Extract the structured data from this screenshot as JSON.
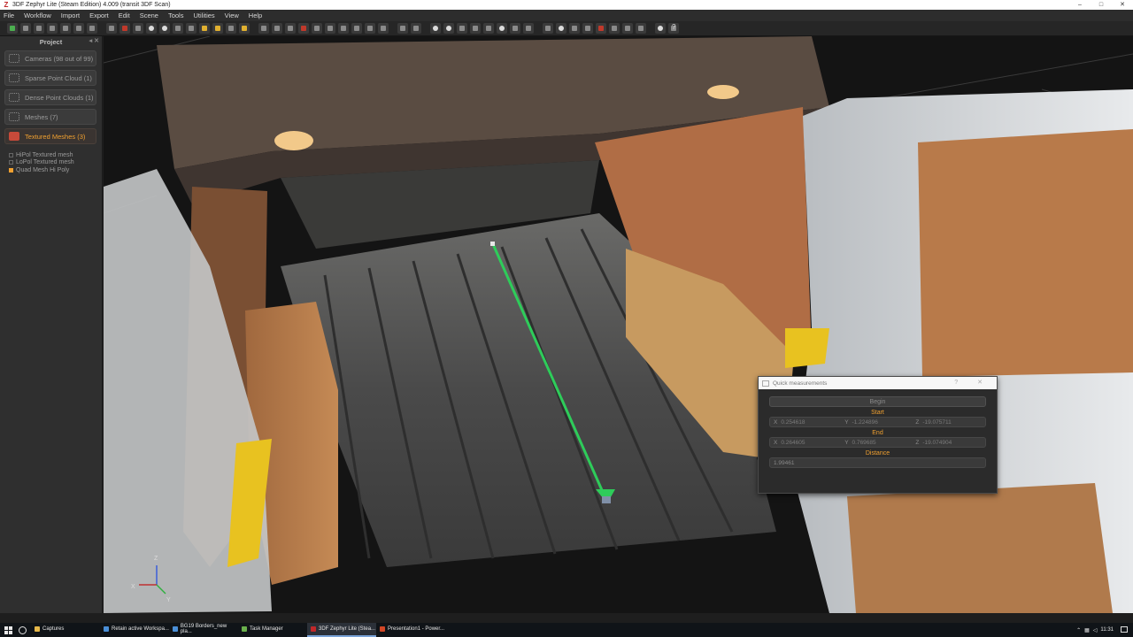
{
  "window": {
    "title": "3DF Zephyr Lite (Steam Edition) 4.009 (transit 3DF Scan)",
    "controls": [
      "–",
      "□",
      "✕"
    ]
  },
  "menu": [
    "File",
    "Workflow",
    "Import",
    "Export",
    "Edit",
    "Scene",
    "Tools",
    "Utilities",
    "View",
    "Help"
  ],
  "toolbar": {
    "help_label": "?"
  },
  "project": {
    "header": "Project",
    "items": [
      {
        "label": "Cameras (98 out of 99)",
        "active": false
      },
      {
        "label": "Sparse Point Cloud (1)",
        "active": false
      },
      {
        "label": "Dense Point Clouds (1)",
        "active": false
      },
      {
        "label": "Meshes (7)",
        "active": false
      },
      {
        "label": "Textured Meshes (3)",
        "active": true
      }
    ],
    "meshes": [
      {
        "label": "HiPol Textured mesh",
        "selected": false
      },
      {
        "label": "LoPol Textured mesh",
        "selected": false
      },
      {
        "label": "Quad Mesh Hi Poly",
        "selected": true
      }
    ]
  },
  "gizmo": {
    "z": "Z",
    "x": "X",
    "y": "Y"
  },
  "quick_measurements": {
    "title": "Quick measurements",
    "begin": "Begin",
    "start_label": "Start",
    "start": {
      "x": "0.254618",
      "y": "-1.224896",
      "z": "-19.075711"
    },
    "end_label": "End",
    "end": {
      "x": "0.264605",
      "y": "0.769685",
      "z": "-19.074904"
    },
    "distance_label": "Distance",
    "distance": "1.99461",
    "axis_x": "X",
    "axis_y": "Y",
    "axis_z": "Z"
  },
  "taskbar": {
    "items": [
      {
        "label": "Captures",
        "active": false
      },
      {
        "label": "Retain active Workspa...",
        "active": false
      },
      {
        "label": "BG19 Borders_new pla...",
        "active": false
      },
      {
        "label": "Task Manager",
        "active": false
      },
      {
        "label": "3DF Zephyr Lite (Stea...",
        "active": true
      },
      {
        "label": "Presentation1 - Power...",
        "active": false
      }
    ],
    "clock": "11:31"
  },
  "colors": {
    "accent": "#f0a030",
    "measure_line": "#2ecc5a",
    "panel_bg": "#2f2f2f"
  }
}
